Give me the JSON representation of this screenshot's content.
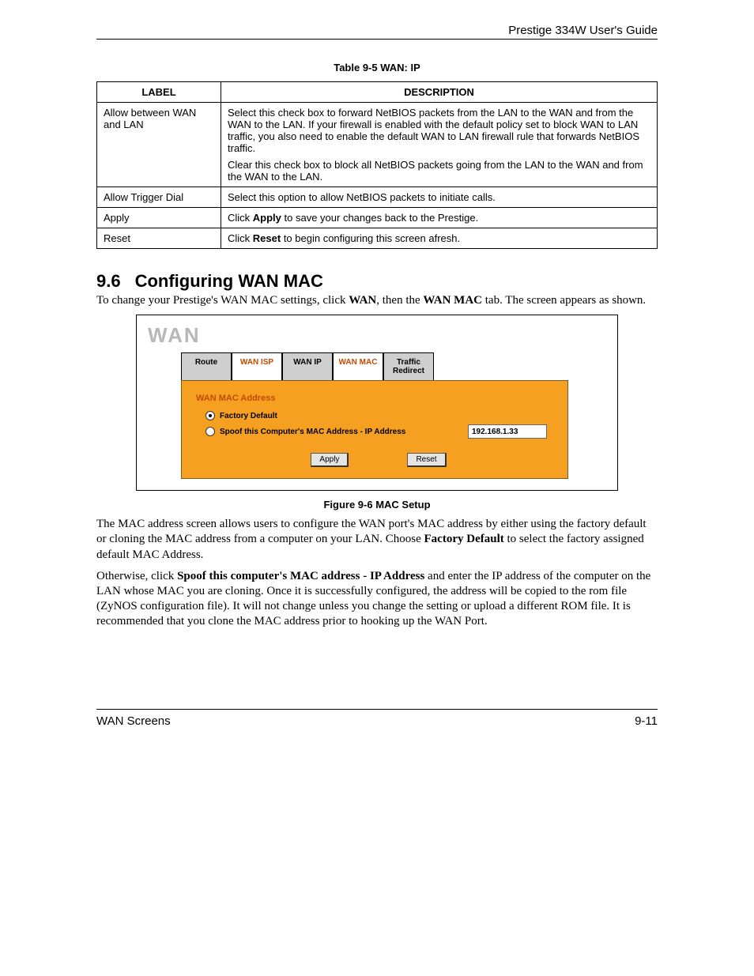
{
  "header": {
    "guide": "Prestige 334W User's Guide"
  },
  "table": {
    "caption": "Table 9-5 WAN: IP",
    "headers": {
      "label": "LABEL",
      "description": "DESCRIPTION"
    },
    "rows": [
      {
        "label": "Allow between WAN and LAN",
        "desc1": "Select this check box to forward NetBIOS packets from the LAN to the WAN and from the WAN to the LAN. If your firewall is enabled with the default policy set to block WAN to LAN traffic, you also need to enable the default WAN to LAN firewall rule that forwards NetBIOS traffic.",
        "desc2": "Clear this check box to block all NetBIOS packets going from the LAN to the WAN and from the WAN to the LAN."
      },
      {
        "label": "Allow Trigger Dial",
        "desc1": "Select this option to allow NetBIOS packets to initiate calls."
      },
      {
        "label": "Apply",
        "desc_pre": "Click ",
        "desc_bold": "Apply",
        "desc_post": " to save your changes back to the Prestige."
      },
      {
        "label": "Reset",
        "desc_pre": "Click ",
        "desc_bold": "Reset",
        "desc_post": " to begin configuring this screen afresh."
      }
    ]
  },
  "section": {
    "number": "9.6",
    "title": "Configuring WAN MAC",
    "intro_pre": "To change your Prestige's WAN MAC settings, click ",
    "intro_b1": "WAN",
    "intro_mid": ", then the ",
    "intro_b2": "WAN MAC",
    "intro_post": " tab.  The screen appears as shown."
  },
  "figure": {
    "wan_title": "WAN",
    "tabs": {
      "route": "Route",
      "wan_isp": "WAN ISP",
      "wan_ip": "WAN IP",
      "wan_mac": "WAN MAC",
      "traffic": "Traffic Redirect"
    },
    "panel": {
      "section_title": "WAN MAC Address",
      "opt_factory": "Factory Default",
      "opt_spoof": "Spoof this Computer's MAC Address - IP Address",
      "ip_value": "192.168.1.33",
      "apply": "Apply",
      "reset": "Reset"
    },
    "caption": "Figure 9-6 MAC Setup"
  },
  "para1": {
    "pre": "The MAC address screen allows users to configure the WAN port's MAC address by either using the factory default or cloning the MAC address from a computer on your LAN. Choose ",
    "bold": "Factory Default",
    "post": " to select the factory assigned default MAC Address."
  },
  "para2": {
    "pre": "Otherwise, click ",
    "bold": "Spoof this computer's MAC address - IP Address",
    "post": " and enter the IP address of the computer on the LAN whose MAC you are cloning. Once it is successfully configured, the address will be copied to the rom file (ZyNOS configuration file). It will not change unless you change the setting or upload a different ROM file.  It is recommended that you clone the MAC address prior to hooking up the WAN Port."
  },
  "footer": {
    "left": "WAN Screens",
    "right": "9-11"
  }
}
